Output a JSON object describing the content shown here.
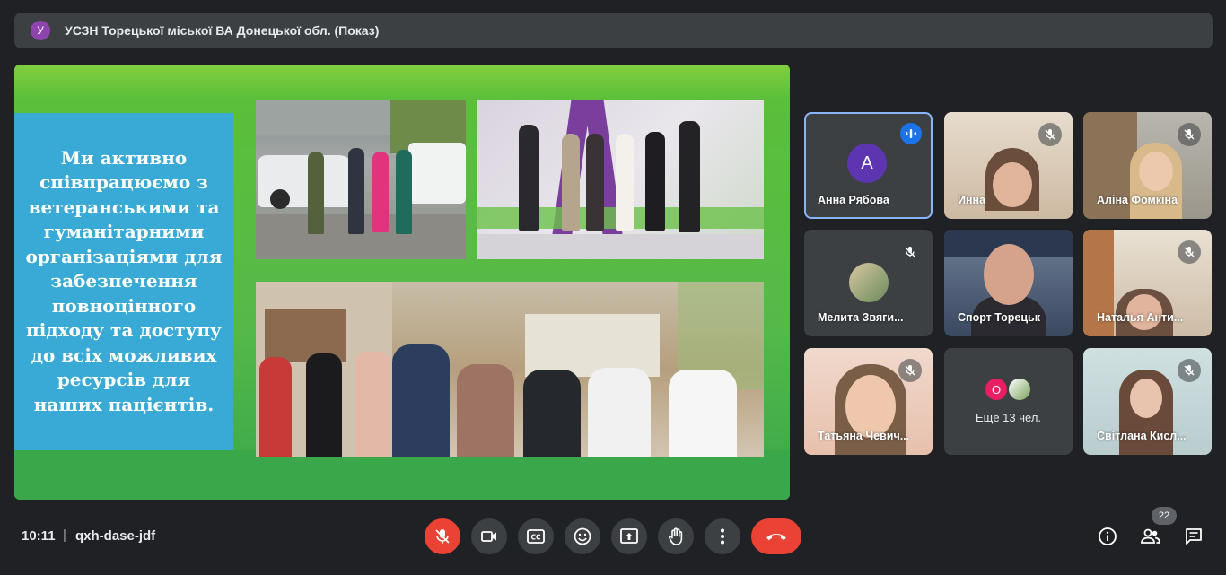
{
  "header": {
    "avatar_letter": "У",
    "avatar_color": "#8e44ad",
    "title": "УСЗН Торецької міської ВА Донецької обл. (Показ)"
  },
  "slide": {
    "text": "Ми активно співпрацюємо з ветеранськими та гуманітарними організаціями для забезпечення повноцінного підходу та доступу до всіх можливих ресурсів для наших пацієнтів."
  },
  "participants": [
    {
      "name": "Анна Рябова",
      "avatar_letter": "A",
      "speaking": true
    },
    {
      "name": "Инна",
      "muted": true
    },
    {
      "name": "Аліна Фомкіна",
      "muted": true
    },
    {
      "name": "Мелита Звяги...",
      "muted": true
    },
    {
      "name": "Спорт Торецьк",
      "muted": false
    },
    {
      "name": "Наталья Анти...",
      "muted": true
    },
    {
      "name": "Татьяна Чевич...",
      "muted": true
    },
    {
      "name": "Ещё 13 чел.",
      "avatar_letter": "О"
    },
    {
      "name": "Світлана Кисл...",
      "muted": true
    }
  ],
  "footer": {
    "time": "10:11",
    "separator": "|",
    "meeting_code": "qxh-dase-jdf",
    "participants_badge": "22"
  },
  "colors": {
    "accent": "#8ab4f8",
    "danger": "#ea4335",
    "slide_green": "#5bbf3a",
    "slide_blue": "#39a9d6"
  }
}
